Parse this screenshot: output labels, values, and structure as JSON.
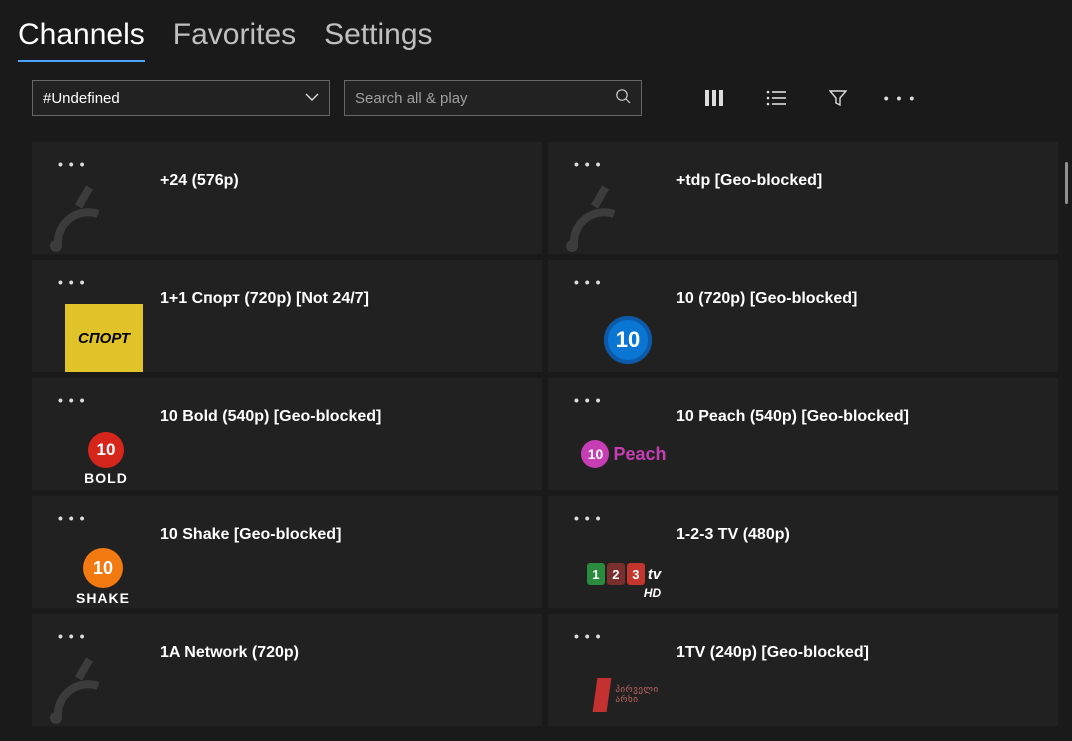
{
  "nav": {
    "tabs": [
      {
        "label": "Channels",
        "active": true
      },
      {
        "label": "Favorites",
        "active": false
      },
      {
        "label": "Settings",
        "active": false
      }
    ]
  },
  "toolbar": {
    "dropdown": {
      "value": "#Undefined"
    },
    "search": {
      "placeholder": "Search all & play",
      "value": ""
    }
  },
  "channels": [
    {
      "title": "+24 (576p)",
      "logo": "none"
    },
    {
      "title": "+tdp [Geo-blocked]",
      "logo": "none"
    },
    {
      "title": "1+1 Спорт (720p) [Not 24/7]",
      "logo": "sport"
    },
    {
      "title": "10 (720p) [Geo-blocked]",
      "logo": "10blue"
    },
    {
      "title": "10 Bold (540p) [Geo-blocked]",
      "logo": "10bold"
    },
    {
      "title": "10 Peach (540p) [Geo-blocked]",
      "logo": "10peach"
    },
    {
      "title": "10 Shake [Geo-blocked]",
      "logo": "10shake"
    },
    {
      "title": "1-2-3 TV (480p)",
      "logo": "123tv"
    },
    {
      "title": "1A Network (720p)",
      "logo": "none"
    },
    {
      "title": "1TV (240p) [Geo-blocked]",
      "logo": "1tv"
    }
  ],
  "logoText": {
    "sport": "СПОРТ",
    "bold": "BOLD",
    "peach": "Peach",
    "shake": "SHAKE",
    "hd": "HD",
    "tv": "tv",
    "georgian": "პირველი\nარხი"
  }
}
